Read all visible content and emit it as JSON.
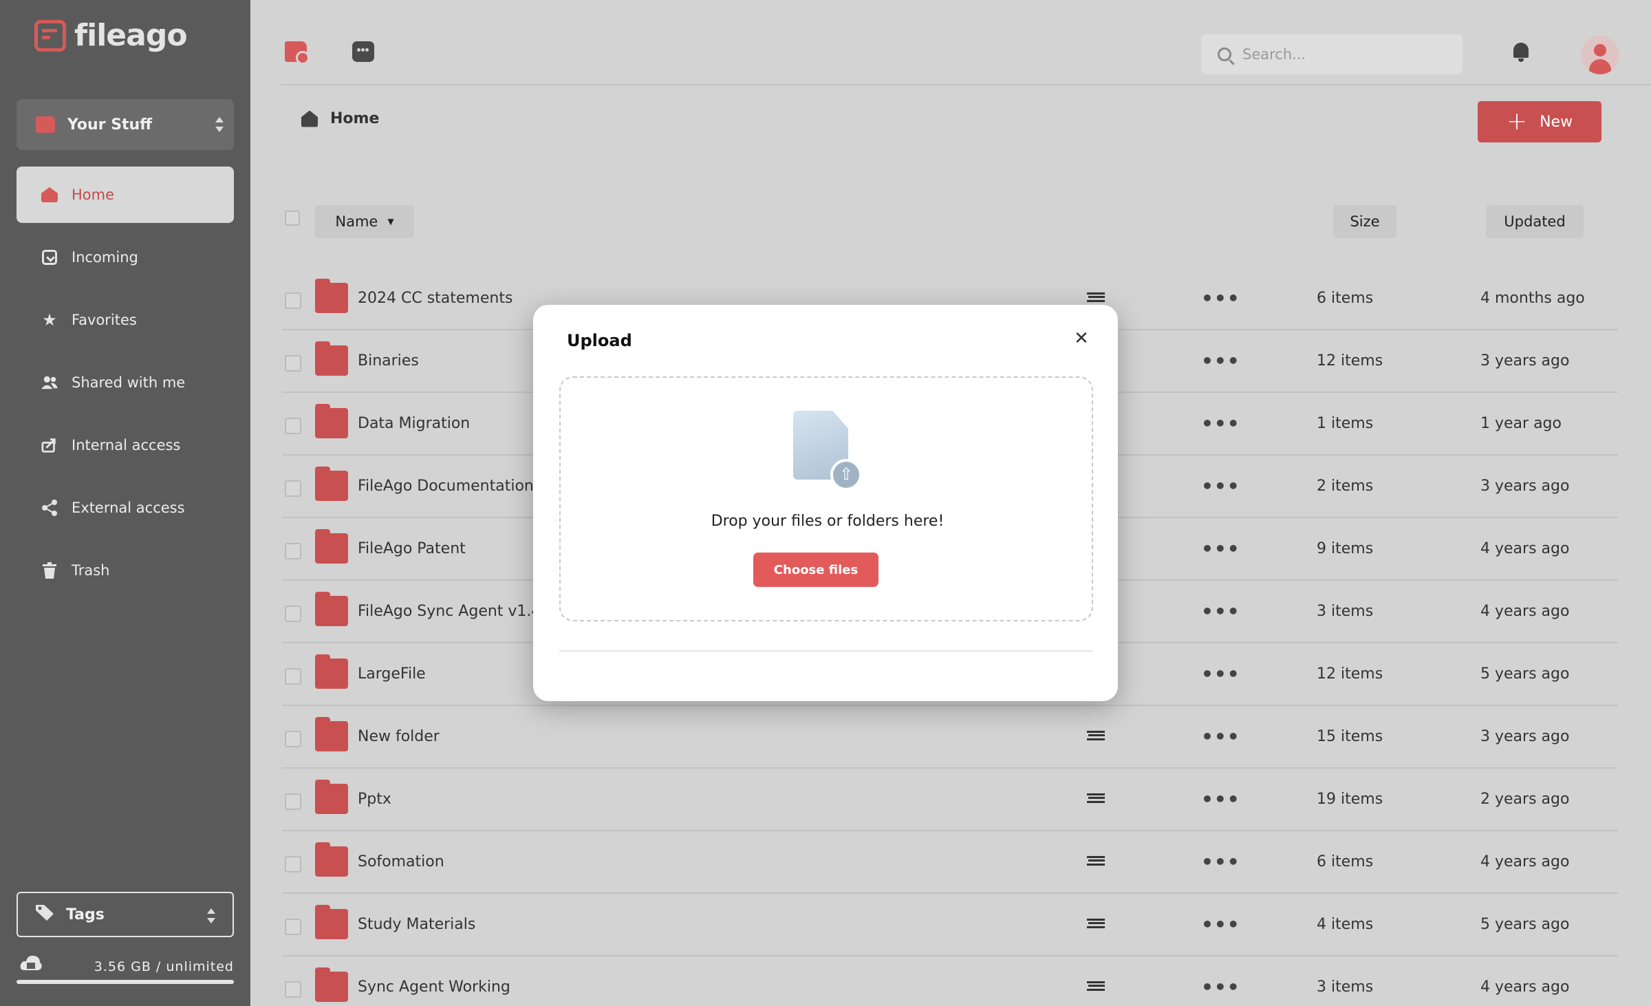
{
  "app": {
    "brand": "fileago",
    "accent": "#d65a5a"
  },
  "sidebar": {
    "workspace": "Your Stuff",
    "items": [
      {
        "label": "Home",
        "icon": "home-icon",
        "active": true
      },
      {
        "label": "Incoming",
        "icon": "incoming-icon"
      },
      {
        "label": "Favorites",
        "icon": "star-icon"
      },
      {
        "label": "Shared with me",
        "icon": "users-icon"
      },
      {
        "label": "Internal access",
        "icon": "share-out-icon"
      },
      {
        "label": "External access",
        "icon": "share-icon"
      },
      {
        "label": "Trash",
        "icon": "trash-icon"
      }
    ],
    "tags_label": "Tags",
    "storage": "3.56 GB / unlimited"
  },
  "topbar": {
    "search_placeholder": "Search..."
  },
  "breadcrumb": {
    "home": "Home"
  },
  "toolbar": {
    "new_label": "New"
  },
  "table": {
    "headers": {
      "name": "Name",
      "size": "Size",
      "updated": "Updated"
    },
    "rows": [
      {
        "name": "2024 CC statements",
        "size": "6 items",
        "updated": "4 months ago"
      },
      {
        "name": "Binaries",
        "size": "12 items",
        "updated": "3 years ago"
      },
      {
        "name": "Data Migration",
        "size": "1 items",
        "updated": "1 year ago"
      },
      {
        "name": "FileAgo Documentation",
        "size": "2 items",
        "updated": "3 years ago"
      },
      {
        "name": "FileAgo Patent",
        "size": "9 items",
        "updated": "4 years ago"
      },
      {
        "name": "FileAgo Sync Agent v1.4.",
        "size": "3 items",
        "updated": "4 years ago"
      },
      {
        "name": "LargeFile",
        "size": "12 items",
        "updated": "5 years ago"
      },
      {
        "name": "New folder",
        "size": "15 items",
        "updated": "3 years ago"
      },
      {
        "name": "Pptx",
        "size": "19 items",
        "updated": "2 years ago"
      },
      {
        "name": "Sofomation",
        "size": "6 items",
        "updated": "4 years ago"
      },
      {
        "name": "Study Materials",
        "size": "4 items",
        "updated": "5 years ago"
      },
      {
        "name": "Sync Agent Working",
        "size": "3 items",
        "updated": "4 years ago"
      }
    ]
  },
  "modal": {
    "title": "Upload",
    "drop_text": "Drop your files or folders here!",
    "choose_label": "Choose files"
  }
}
